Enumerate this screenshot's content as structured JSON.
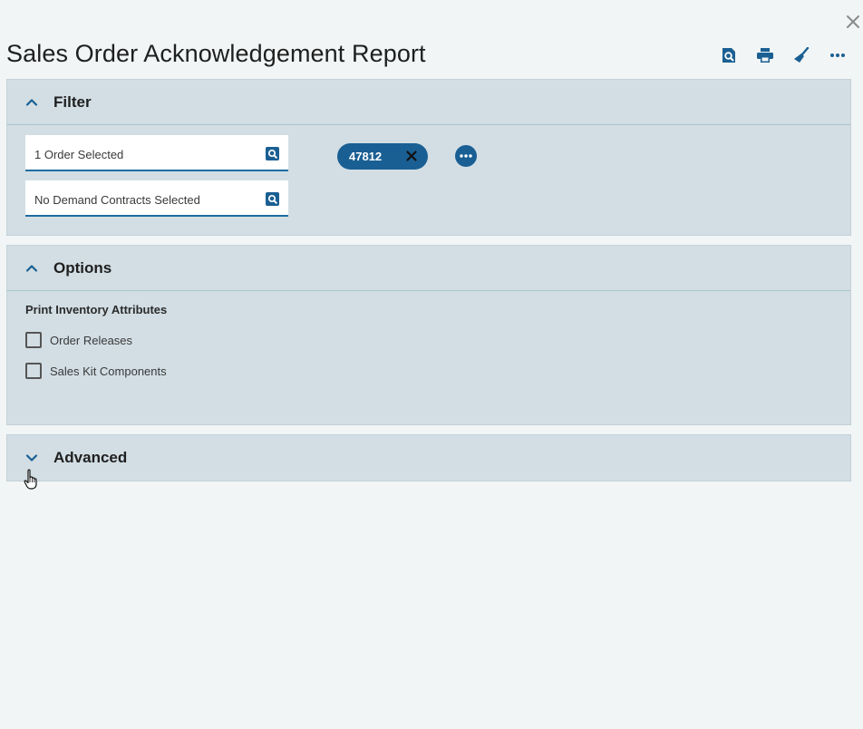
{
  "header": {
    "title": "Sales Order Acknowledgement Report",
    "close_icon": "close-icon",
    "toolbar_icons": [
      "preview-icon",
      "print-icon",
      "clear-icon",
      "more-icon"
    ]
  },
  "filter": {
    "title": "Filter",
    "expanded": true,
    "orders_field": {
      "value": "1 Order Selected",
      "icon": "search-icon"
    },
    "contracts_field": {
      "value": "No Demand Contracts Selected",
      "icon": "search-icon"
    },
    "chips": [
      {
        "label": "47812"
      }
    ]
  },
  "options": {
    "title": "Options",
    "expanded": true,
    "group_label": "Print Inventory Attributes",
    "checkboxes": [
      {
        "label": "Order Releases",
        "checked": false
      },
      {
        "label": "Sales Kit Components",
        "checked": false
      }
    ]
  },
  "advanced": {
    "title": "Advanced",
    "expanded": false
  },
  "colors": {
    "accent": "#1a5f93",
    "panel_bg": "#d2dee4",
    "page_bg": "#f1f5f5"
  }
}
